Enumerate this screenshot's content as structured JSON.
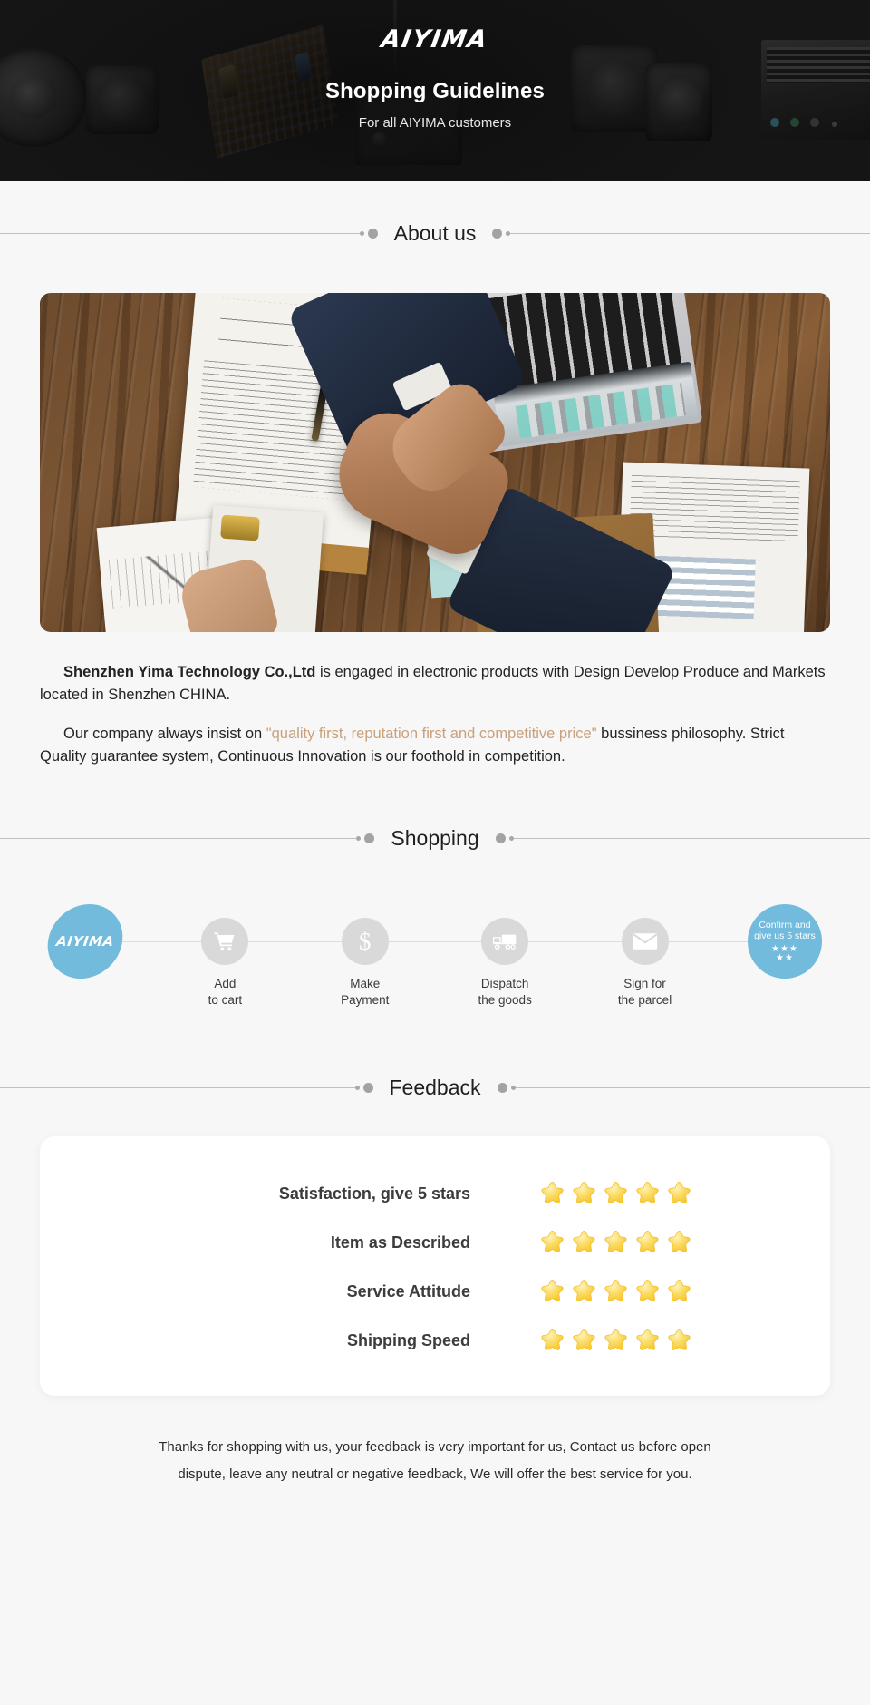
{
  "banner": {
    "logo": "AIYIMA",
    "title": "Shopping Guidelines",
    "subtitle": "For all AIYIMA customers"
  },
  "sections": {
    "about_title": "About us",
    "shopping_title": "Shopping",
    "feedback_title": "Feedback"
  },
  "about": {
    "p1_strong": "Shenzhen Yima Technology Co.,Ltd",
    "p1_rest": " is engaged in electronic products with Design Develop Produce and Markets located in Shenzhen CHINA.",
    "p2_before": "Our company always insist on ",
    "p2_quote": "\"quality first, reputation first and competitive price\"",
    "p2_after": " bussiness philosophy. Strict Quality guarantee system, Continuous Innovation is our foothold in competition."
  },
  "steps": [
    {
      "icon": "aiyima-logo-icon",
      "badge": "AIYIMA",
      "label": ""
    },
    {
      "icon": "shopping-cart-icon",
      "label": "Add\nto cart"
    },
    {
      "icon": "dollar-sign-icon",
      "label": "Make\nPayment"
    },
    {
      "icon": "delivery-truck-icon",
      "label": "Dispatch\nthe goods"
    },
    {
      "icon": "envelope-icon",
      "label": "Sign for\nthe parcel"
    },
    {
      "icon": "five-stars-icon",
      "cta_line1": "Confirm and",
      "cta_line2": "give us 5 stars",
      "stars_top": "★★★",
      "stars_bottom": "★★",
      "label": ""
    }
  ],
  "feedback": {
    "rows": [
      {
        "label": "Satisfaction, give 5 stars",
        "stars": 5
      },
      {
        "label": "Item as Described",
        "stars": 5
      },
      {
        "label": "Service Attitude",
        "stars": 5
      },
      {
        "label": "Shipping Speed",
        "stars": 5
      }
    ]
  },
  "footer": {
    "line1": "Thanks for shopping with us, your feedback is very important for us, Contact us before open",
    "line2": "dispute, leave any neutral or negative feedback, We will offer the best service for you."
  },
  "colors": {
    "accent_blue": "#72bbdd",
    "banner_bg": "#161616",
    "page_bg": "#f7f7f7",
    "quote_text": "#c9a07a",
    "star_yellow": "#fbd95b"
  }
}
